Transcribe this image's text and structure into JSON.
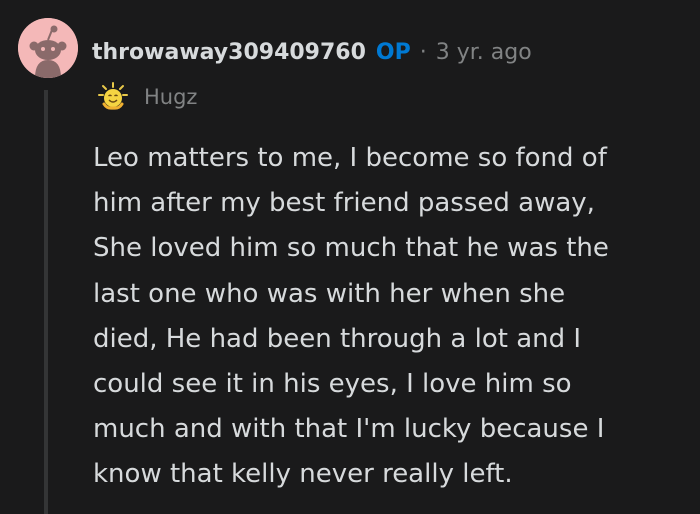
{
  "comment": {
    "author": "throwaway309409760",
    "op_badge": "OP",
    "separator": "·",
    "timestamp": "3 yr. ago",
    "flair": {
      "icon": "hugz-award-icon",
      "label": "Hugz"
    },
    "body_lines": [
      "Leo matters to me, I become so fond of",
      "him after my best friend passed away,",
      "She loved him so much that he was the",
      "last one who was with her when she",
      "died, He had been through a lot and I",
      "could see it in his eyes, I love him so",
      "much and with that I'm lucky because I",
      "know that kelly never really left."
    ]
  },
  "colors": {
    "background": "#1a1a1b",
    "text": "#d7dadc",
    "muted": "#818384",
    "op_badge": "#0079d3",
    "avatar_bg": "#f4b8b8",
    "thread_line": "#343536"
  }
}
